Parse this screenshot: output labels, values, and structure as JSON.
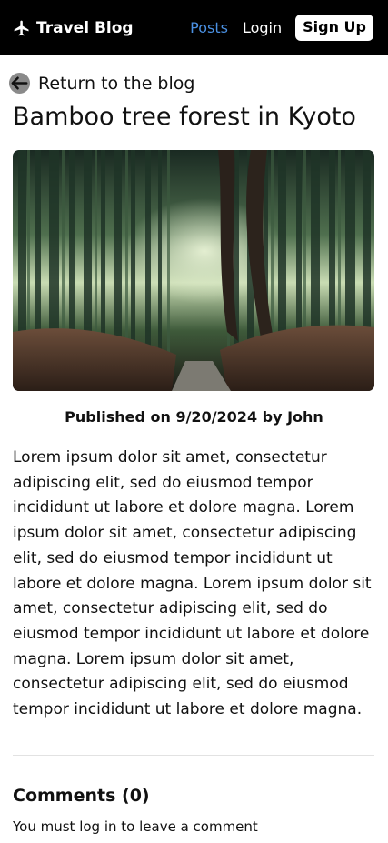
{
  "navbar": {
    "brand_label": "Travel Blog",
    "brand_icon": "airplane-icon",
    "links": {
      "posts": "Posts",
      "login": "Login",
      "signup": "Sign Up"
    },
    "active_color": "#4a90e2",
    "background": "#000000"
  },
  "back_link": {
    "label": "Return to the blog",
    "icon": "arrow-left-icon"
  },
  "post": {
    "title": "Bamboo tree forest in Kyoto",
    "image_subject": "bamboo-forest-photo",
    "meta": "Published on 9/20/2024 by John",
    "body": "Lorem ipsum dolor sit amet, consectetur adipiscing elit, sed do eiusmod tempor incididunt ut labore et dolore magna. Lorem ipsum dolor sit amet, consectetur adipiscing elit, sed do eiusmod tempor incididunt ut labore et dolore magna. Lorem ipsum dolor sit amet, consectetur adipiscing elit, sed do eiusmod tempor incididunt ut labore et dolore magna. Lorem ipsum dolor sit amet, consectetur adipiscing elit, sed do eiusmod tempor incididunt ut labore et dolore magna."
  },
  "comments": {
    "heading": "Comments (0)",
    "note": "You must log in to leave a comment"
  }
}
